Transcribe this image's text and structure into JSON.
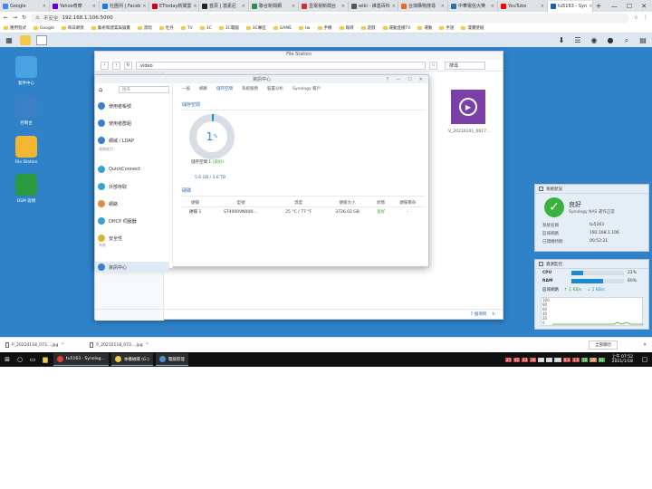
{
  "browser": {
    "tabs": [
      {
        "label": "Google",
        "color": "#4285f4"
      },
      {
        "label": "Yahoo奇摩",
        "color": "#6001d2"
      },
      {
        "label": "社團列 | Faceb",
        "color": "#1877f2"
      },
      {
        "label": "ETtoday新聞雲",
        "color": "#d0021b"
      },
      {
        "label": "首頁 | 激素尼",
        "color": "#222222"
      },
      {
        "label": "聯合新聞網",
        "color": "#2e8b57"
      },
      {
        "label": "壹電視新聞台",
        "color": "#cc3333"
      },
      {
        "label": "wiki - 維基百科",
        "color": "#555555"
      },
      {
        "label": "台灣購物搜尋",
        "color": "#e06b2b"
      },
      {
        "label": "中華電信大樂",
        "color": "#2a6db0"
      },
      {
        "label": "YouTube",
        "color": "#ff0000"
      },
      {
        "label": "tu5163 - Syn",
        "color": "#1a5fa8",
        "active": true
      }
    ],
    "new_tab": "+",
    "win_controls": [
      "—",
      "☐",
      "✕"
    ],
    "nav": {
      "back": "←",
      "forward": "→",
      "reload": "↻"
    },
    "insecure_label": "不安全",
    "url": "192.168.1.106:5000",
    "bookmarks": [
      "應用程式",
      "Google",
      "每日網頁",
      "藝術和建築與論畫",
      "黑暗",
      "牡丹",
      "TV",
      "3C",
      "3C電腦",
      "3C專區",
      "GAME",
      "tw",
      "手機",
      "報導",
      "遊戲",
      "運動直播TV",
      "運動",
      "手語",
      "漫畫壁紙"
    ]
  },
  "dsm": {
    "desktop_icons": [
      {
        "label": "套件中心",
        "color": "#4aa3e0"
      },
      {
        "label": "控制台",
        "color": "#3b7fc4"
      },
      {
        "label": "File Station",
        "color": "#f2b632"
      },
      {
        "label": "DSM 說明",
        "color": "#2b9a3f"
      }
    ]
  },
  "file_station": {
    "title": "File Station",
    "path": "video",
    "search": "搜尋",
    "video_name": "V_20210101_0617...",
    "footer": "7 個項目"
  },
  "info_center": {
    "title": "資訊中心",
    "search_placeholder": "搜尋",
    "menu": [
      {
        "label": "使用者帳號",
        "color": "#3b7fc4"
      },
      {
        "label": "使用者群組",
        "color": "#3b7fc4"
      },
      {
        "label": "網域 / LDAP",
        "color": "#3b7fc4"
      },
      {
        "label": "QuickConnect",
        "color": "#3aa0d8"
      },
      {
        "label": "外部存取",
        "color": "#3aa0d8"
      },
      {
        "label": "網路",
        "color": "#e8893a"
      },
      {
        "label": "DHCP 伺服器",
        "color": "#3aa0d8"
      },
      {
        "label": "安全性",
        "color": "#e0b030"
      },
      {
        "label": "資訊中心",
        "color": "#3b7fc4"
      }
    ],
    "sec_connectivity": "連線能力",
    "sec_system": "系統",
    "tabs": [
      "一般",
      "網路",
      "儲存空間",
      "系統服務",
      "裝置分析",
      "Synology 帳戶"
    ],
    "storage_title": "儲存空間",
    "usage_percent": 1,
    "percent_sign": "%",
    "volume_label": "儲存空間 1",
    "volume_status": "(良好)",
    "used_total": "5.6 GB / 3.6 TB",
    "hdd_title": "硬碟",
    "hdd_headers": [
      "硬碟",
      "型號",
      "溫度",
      "硬碟大小",
      "狀態",
      "硬碟壽命"
    ],
    "hdd_row": [
      "硬碟 1",
      "ST4000VN008-...",
      "25 °C / 77 °F",
      "3726.02 GB",
      "良好",
      "-"
    ],
    "win_controls": [
      "?",
      "—",
      "☐",
      "✕"
    ]
  },
  "system_health": {
    "title": "系統狀況",
    "status": "良好",
    "desc": "Synology NAS 運作正常",
    "rows": [
      {
        "k": "系統名稱",
        "v": "tu5163"
      },
      {
        "k": "區域網路",
        "v": "192.168.1.106"
      },
      {
        "k": "已開機時間",
        "v": "00:52:21"
      }
    ]
  },
  "resource_monitor": {
    "title": "資源監控",
    "cpu_label": "CPU",
    "cpu_pct": 22,
    "cpu_text": "22%",
    "ram_label": "RAM",
    "ram_pct": 60,
    "ram_text": "60%",
    "net_label": "區域網路",
    "up": "↑ 1 KB/s",
    "down": "↓ 1 KB/s",
    "chart_ticks": [
      "100",
      "80",
      "60",
      "40",
      "20",
      "0"
    ]
  },
  "downloads": {
    "items": [
      "P_20210118_073....jpg",
      "P_20210118_073....jpg"
    ],
    "show_all": "全部顯示"
  },
  "taskbar": {
    "apps": [
      {
        "label": "tu5163 - Synolog...",
        "color": "#e44134"
      },
      {
        "label": "本機磁碟 (G:)",
        "color": "#f2c94c"
      },
      {
        "label": "電腦管理",
        "color": "#4a8fd4"
      }
    ],
    "tray": [
      "25",
      "42",
      "43",
      "26",
      "28",
      "28",
      "19",
      "0.3",
      "1.5",
      "10",
      "29",
      "61"
    ],
    "time": "上午 07:52",
    "date": "2021/1/18"
  }
}
